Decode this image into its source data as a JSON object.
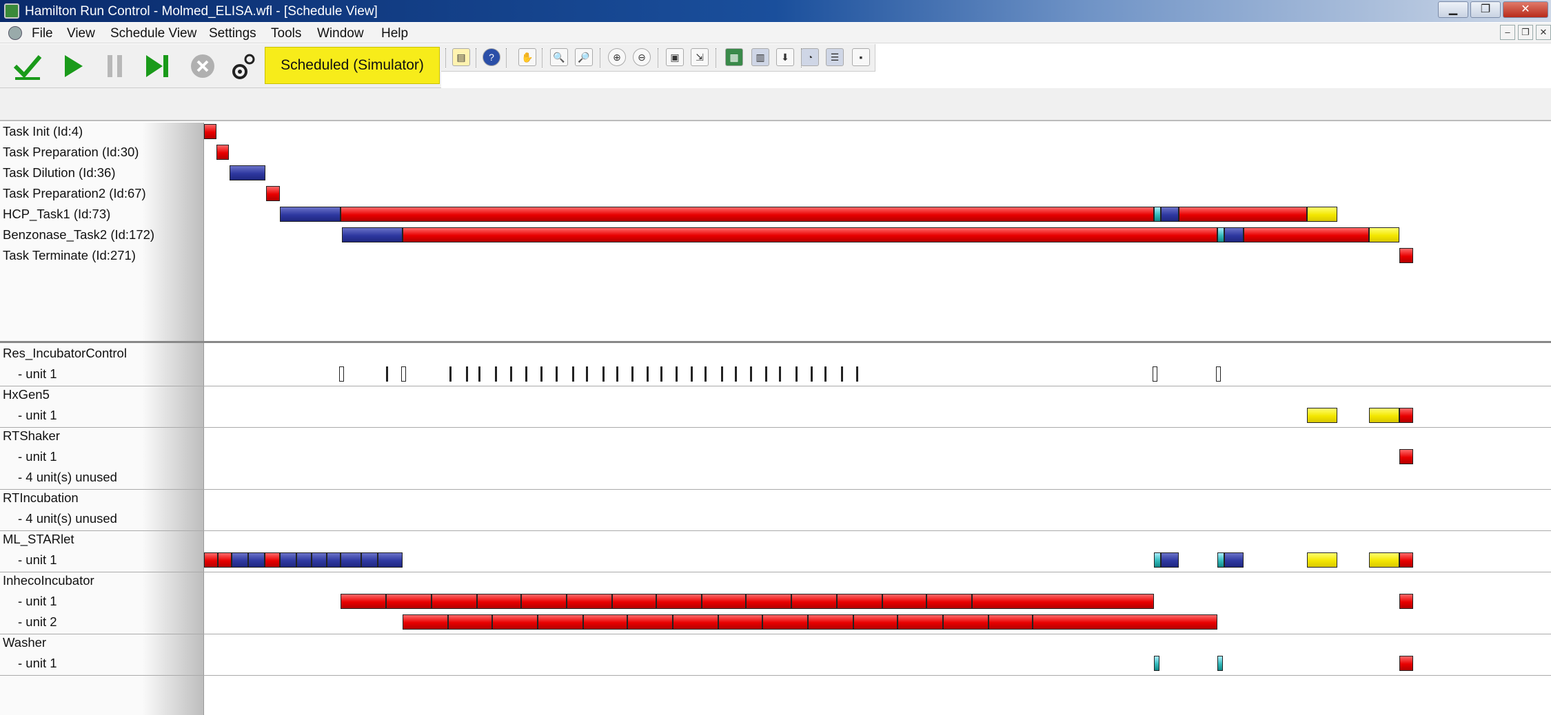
{
  "window": {
    "title": "Hamilton Run Control - Molmed_ELISA.wfl - [Schedule View]",
    "minimize": "▁",
    "maximize": "❐",
    "close": "✕"
  },
  "menu": [
    "File",
    "View",
    "Schedule View",
    "Settings",
    "Tools",
    "Window",
    "Help"
  ],
  "mdi": {
    "minimize": "–",
    "restore": "❐",
    "close": "✕"
  },
  "toolbar": {
    "status": "Scheduled (Simulator)",
    "icons": [
      "check-icon",
      "play-icon",
      "pause-icon",
      "step-icon",
      "abort-icon",
      "settings-icon"
    ]
  },
  "colors": {
    "red": "#e80000",
    "blue": "#2e38a0",
    "yellow": "#f3e600",
    "cyan": "#33bbbb",
    "status_bg": "#f7ec1a"
  },
  "tasks": [
    {
      "label": "Task Init (Id:4)"
    },
    {
      "label": "Task Preparation (Id:30)"
    },
    {
      "label": "Task Dilution (Id:36)"
    },
    {
      "label": "Task Preparation2 (Id:67)"
    },
    {
      "label": "HCP_Task1 (Id:73)"
    },
    {
      "label": "Benzonase_Task2 (Id:172)"
    },
    {
      "label": "Task Terminate (Id:271)"
    }
  ],
  "resources": [
    {
      "name": "Res_IncubatorControl",
      "units": [
        "- unit 1"
      ]
    },
    {
      "name": "HxGen5",
      "units": [
        "- unit 1"
      ]
    },
    {
      "name": "RTShaker",
      "units": [
        "- unit 1",
        "- 4 unit(s) unused"
      ]
    },
    {
      "name": "RTIncubation",
      "units": [
        "- 4 unit(s) unused"
      ]
    },
    {
      "name": "ML_STARlet",
      "units": [
        "- unit 1"
      ]
    },
    {
      "name": "InhecoIncubator",
      "units": [
        "- unit 1",
        "- unit 2"
      ]
    },
    {
      "name": "Washer",
      "units": [
        "- unit 1"
      ]
    }
  ]
}
